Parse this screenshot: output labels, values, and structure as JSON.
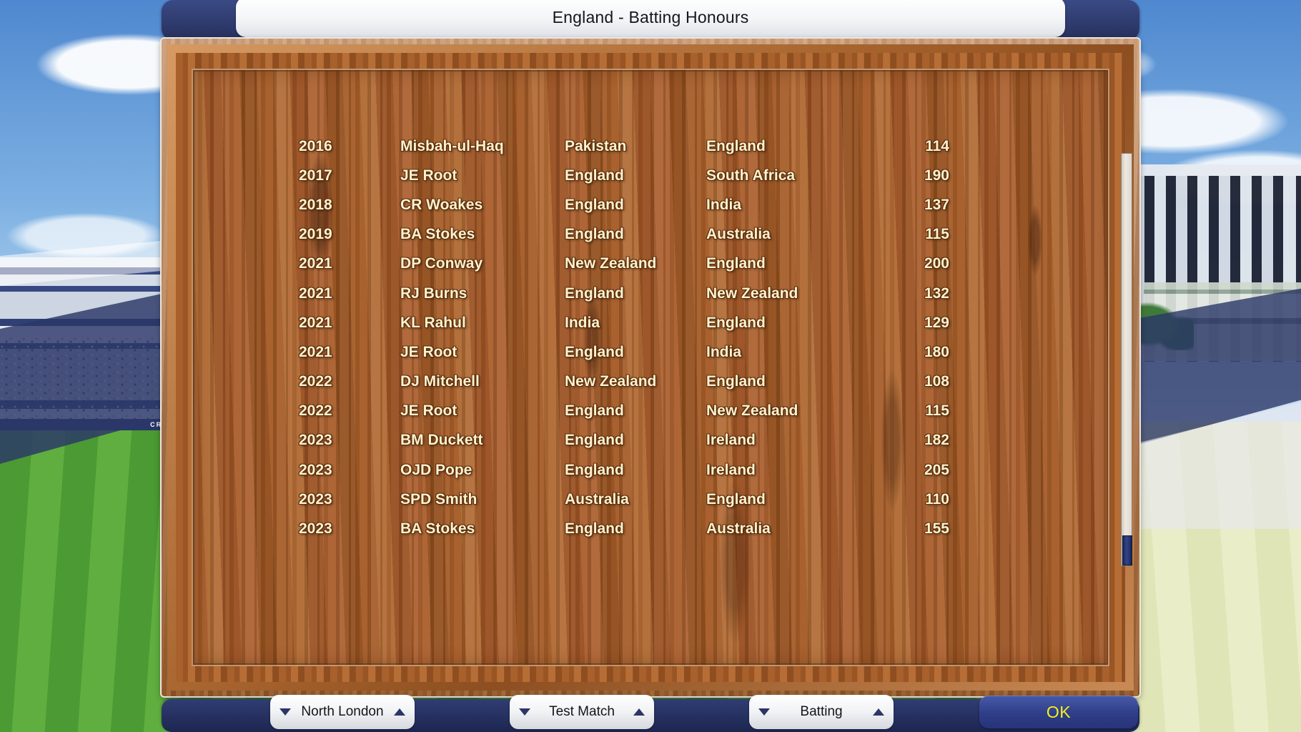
{
  "window": {
    "title": "England - Batting Honours"
  },
  "background": {
    "watermark": "CRICKET CAPTAIN"
  },
  "table": {
    "rows": [
      {
        "year": "2016",
        "player": "Misbah-ul-Haq",
        "team": "Pakistan",
        "opponent": "England",
        "score": "114"
      },
      {
        "year": "2017",
        "player": "JE Root",
        "team": "England",
        "opponent": "South Africa",
        "score": "190"
      },
      {
        "year": "2018",
        "player": "CR Woakes",
        "team": "England",
        "opponent": "India",
        "score": "137"
      },
      {
        "year": "2019",
        "player": "BA Stokes",
        "team": "England",
        "opponent": "Australia",
        "score": "115"
      },
      {
        "year": "2021",
        "player": "DP Conway",
        "team": "New Zealand",
        "opponent": "England",
        "score": "200"
      },
      {
        "year": "2021",
        "player": "RJ Burns",
        "team": "England",
        "opponent": "New Zealand",
        "score": "132"
      },
      {
        "year": "2021",
        "player": "KL Rahul",
        "team": "India",
        "opponent": "England",
        "score": "129"
      },
      {
        "year": "2021",
        "player": "JE Root",
        "team": "England",
        "opponent": "India",
        "score": "180"
      },
      {
        "year": "2022",
        "player": "DJ Mitchell",
        "team": "New Zealand",
        "opponent": "England",
        "score": "108"
      },
      {
        "year": "2022",
        "player": "JE Root",
        "team": "England",
        "opponent": "New Zealand",
        "score": "115"
      },
      {
        "year": "2023",
        "player": "BM Duckett",
        "team": "England",
        "opponent": "Ireland",
        "score": "182"
      },
      {
        "year": "2023",
        "player": "OJD Pope",
        "team": "England",
        "opponent": "Ireland",
        "score": "205"
      },
      {
        "year": "2023",
        "player": "SPD Smith",
        "team": "Australia",
        "opponent": "England",
        "score": "110"
      },
      {
        "year": "2023",
        "player": "BA Stokes",
        "team": "England",
        "opponent": "Australia",
        "score": "155"
      }
    ]
  },
  "footer": {
    "dropdowns": [
      {
        "name": "ground",
        "value": "North London"
      },
      {
        "name": "match_type",
        "value": "Test Match"
      },
      {
        "name": "discipline",
        "value": "Batting"
      }
    ],
    "ok_label": "OK"
  },
  "colors": {
    "text_cream": "#fcf2ce",
    "navy": "#2b3768",
    "ok_yellow": "#f5f21c",
    "wood": "#a8602c"
  }
}
